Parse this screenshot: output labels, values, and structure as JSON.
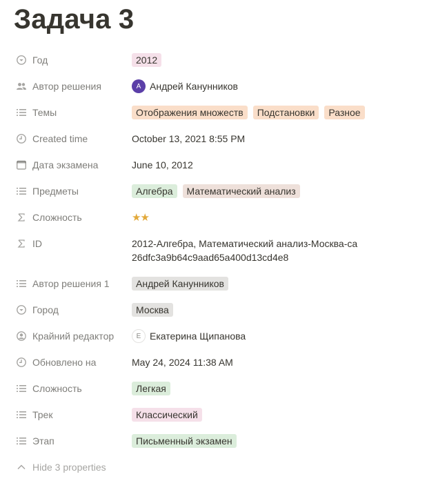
{
  "page": {
    "title": "Задача 3"
  },
  "properties": {
    "year": {
      "label": "Год",
      "icon": "select-icon",
      "tags": [
        "2012"
      ]
    },
    "author": {
      "label": "Автор решения",
      "icon": "people-icon",
      "avatar_initial": "А",
      "name": "Андрей Канунников"
    },
    "topics": {
      "label": "Темы",
      "icon": "list-icon",
      "tags": [
        "Отображения множеств",
        "Подстановки",
        "Разное"
      ]
    },
    "created": {
      "label": "Created time",
      "icon": "clock-icon",
      "value": "October 13, 2021 8:55 PM"
    },
    "exam_date": {
      "label": "Дата экзамена",
      "icon": "calendar-icon",
      "value": "June 10, 2012"
    },
    "subjects": {
      "label": "Предметы",
      "icon": "list-icon",
      "tags": [
        "Алгебра",
        "Математический анализ"
      ]
    },
    "difficulty_formula": {
      "label": "Сложность",
      "icon": "sigma-icon",
      "stars": "★★",
      "star_count": 2
    },
    "id": {
      "label": "ID",
      "icon": "sigma-icon",
      "value": "2012-Алгебра, Математический анализ-Москва-ca26dfc3a9b64c9aad65a400d13cd4e8"
    },
    "author1": {
      "label": "Автор решения 1",
      "icon": "list-icon",
      "tags": [
        "Андрей Канунников"
      ]
    },
    "city": {
      "label": "Город",
      "icon": "select-icon",
      "tags": [
        "Москва"
      ]
    },
    "last_editor": {
      "label": "Крайний редактор",
      "icon": "person-icon",
      "avatar_initial": "E",
      "name": "Екатерина Щипанова"
    },
    "updated": {
      "label": "Обновлено на",
      "icon": "clock-icon",
      "value": "May 24, 2024 11:38 AM"
    },
    "difficulty": {
      "label": "Сложность",
      "icon": "list-icon",
      "tags": [
        "Легкая"
      ]
    },
    "track": {
      "label": "Трек",
      "icon": "list-icon",
      "tags": [
        "Классический"
      ]
    },
    "stage": {
      "label": "Этап",
      "icon": "list-icon",
      "tags": [
        "Письменный экзамен"
      ]
    }
  },
  "hide_label": "Hide 3 properties",
  "colors": {
    "pink": "#f5e0e9",
    "orange": "#fadec9",
    "green": "#dbeddb",
    "brown": "#eee0da",
    "gray": "#e3e2e0",
    "star": "#e2a93b",
    "avatar": "#5b3fa8"
  }
}
